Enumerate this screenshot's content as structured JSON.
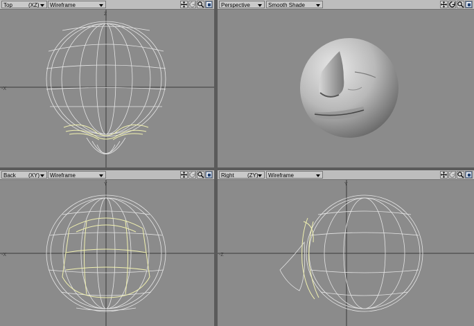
{
  "viewports": {
    "top_left": {
      "view": "Top",
      "axes": "(XZ)",
      "mode": "Wireframe"
    },
    "top_right": {
      "view": "Perspective",
      "mode": "Smooth Shade"
    },
    "bottom_left": {
      "view": "Back",
      "axes": "(XY)",
      "mode": "Wireframe"
    },
    "bottom_right": {
      "view": "Right",
      "axes": "(ZY)",
      "mode": "Wireframe"
    }
  },
  "icons": [
    "move-icon",
    "rotate-icon",
    "zoom-icon",
    "maximize-icon"
  ],
  "colors": {
    "background": "#8b8b8b",
    "header": "#bdbdbd",
    "wire": "#e6e6e6",
    "selected_wire": "#f2f2b0",
    "axis": "#3a3a3a"
  }
}
